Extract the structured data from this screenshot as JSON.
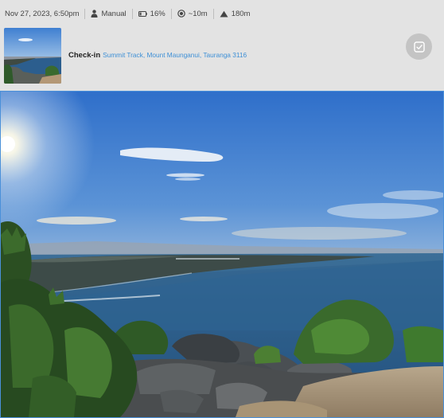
{
  "meta": {
    "datetime": "Nov 27, 2023, 6:50pm",
    "mode": "Manual",
    "battery": "16%",
    "accuracy": "~10m",
    "elevation": "180m"
  },
  "checkin": {
    "title": "Check-in",
    "location": "Summit Track, Mount Maunganui, Tauranga 3116"
  },
  "icons": {
    "mode": "person-icon",
    "battery": "battery-icon",
    "accuracy": "target-icon",
    "elevation": "mountain-icon",
    "action": "checkbox-icon"
  },
  "colors": {
    "link": "#3d8fd6",
    "selection_border": "#4a90d9",
    "action_button": "#c4c4c4"
  }
}
